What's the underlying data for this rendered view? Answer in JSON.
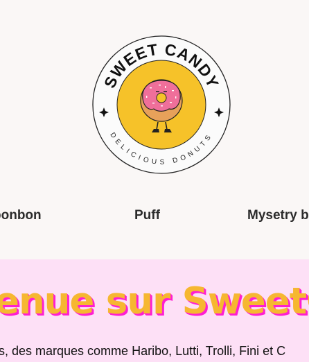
{
  "logo": {
    "brand_text": "SWEET CANDY",
    "tagline_text": "DELICIOUS DONUTS",
    "colors": {
      "ring": "#fbfbfb",
      "ring_border": "#222222",
      "inner_circle": "#f6c229",
      "icing": "#ef6f9a",
      "dough": "#e7a15a"
    }
  },
  "nav": {
    "items": [
      {
        "label": "bonbon"
      },
      {
        "label": "Puff"
      },
      {
        "label": "Mysetry b"
      }
    ]
  },
  "banner": {
    "title": "enue sur SweetCa",
    "intro": "s, des marques comme Haribo, Lutti, Trolli, Fini et C",
    "colors": {
      "background": "#fde0f6",
      "title_fill": "#f6b731",
      "title_shadow": "#ff1fd0"
    }
  }
}
